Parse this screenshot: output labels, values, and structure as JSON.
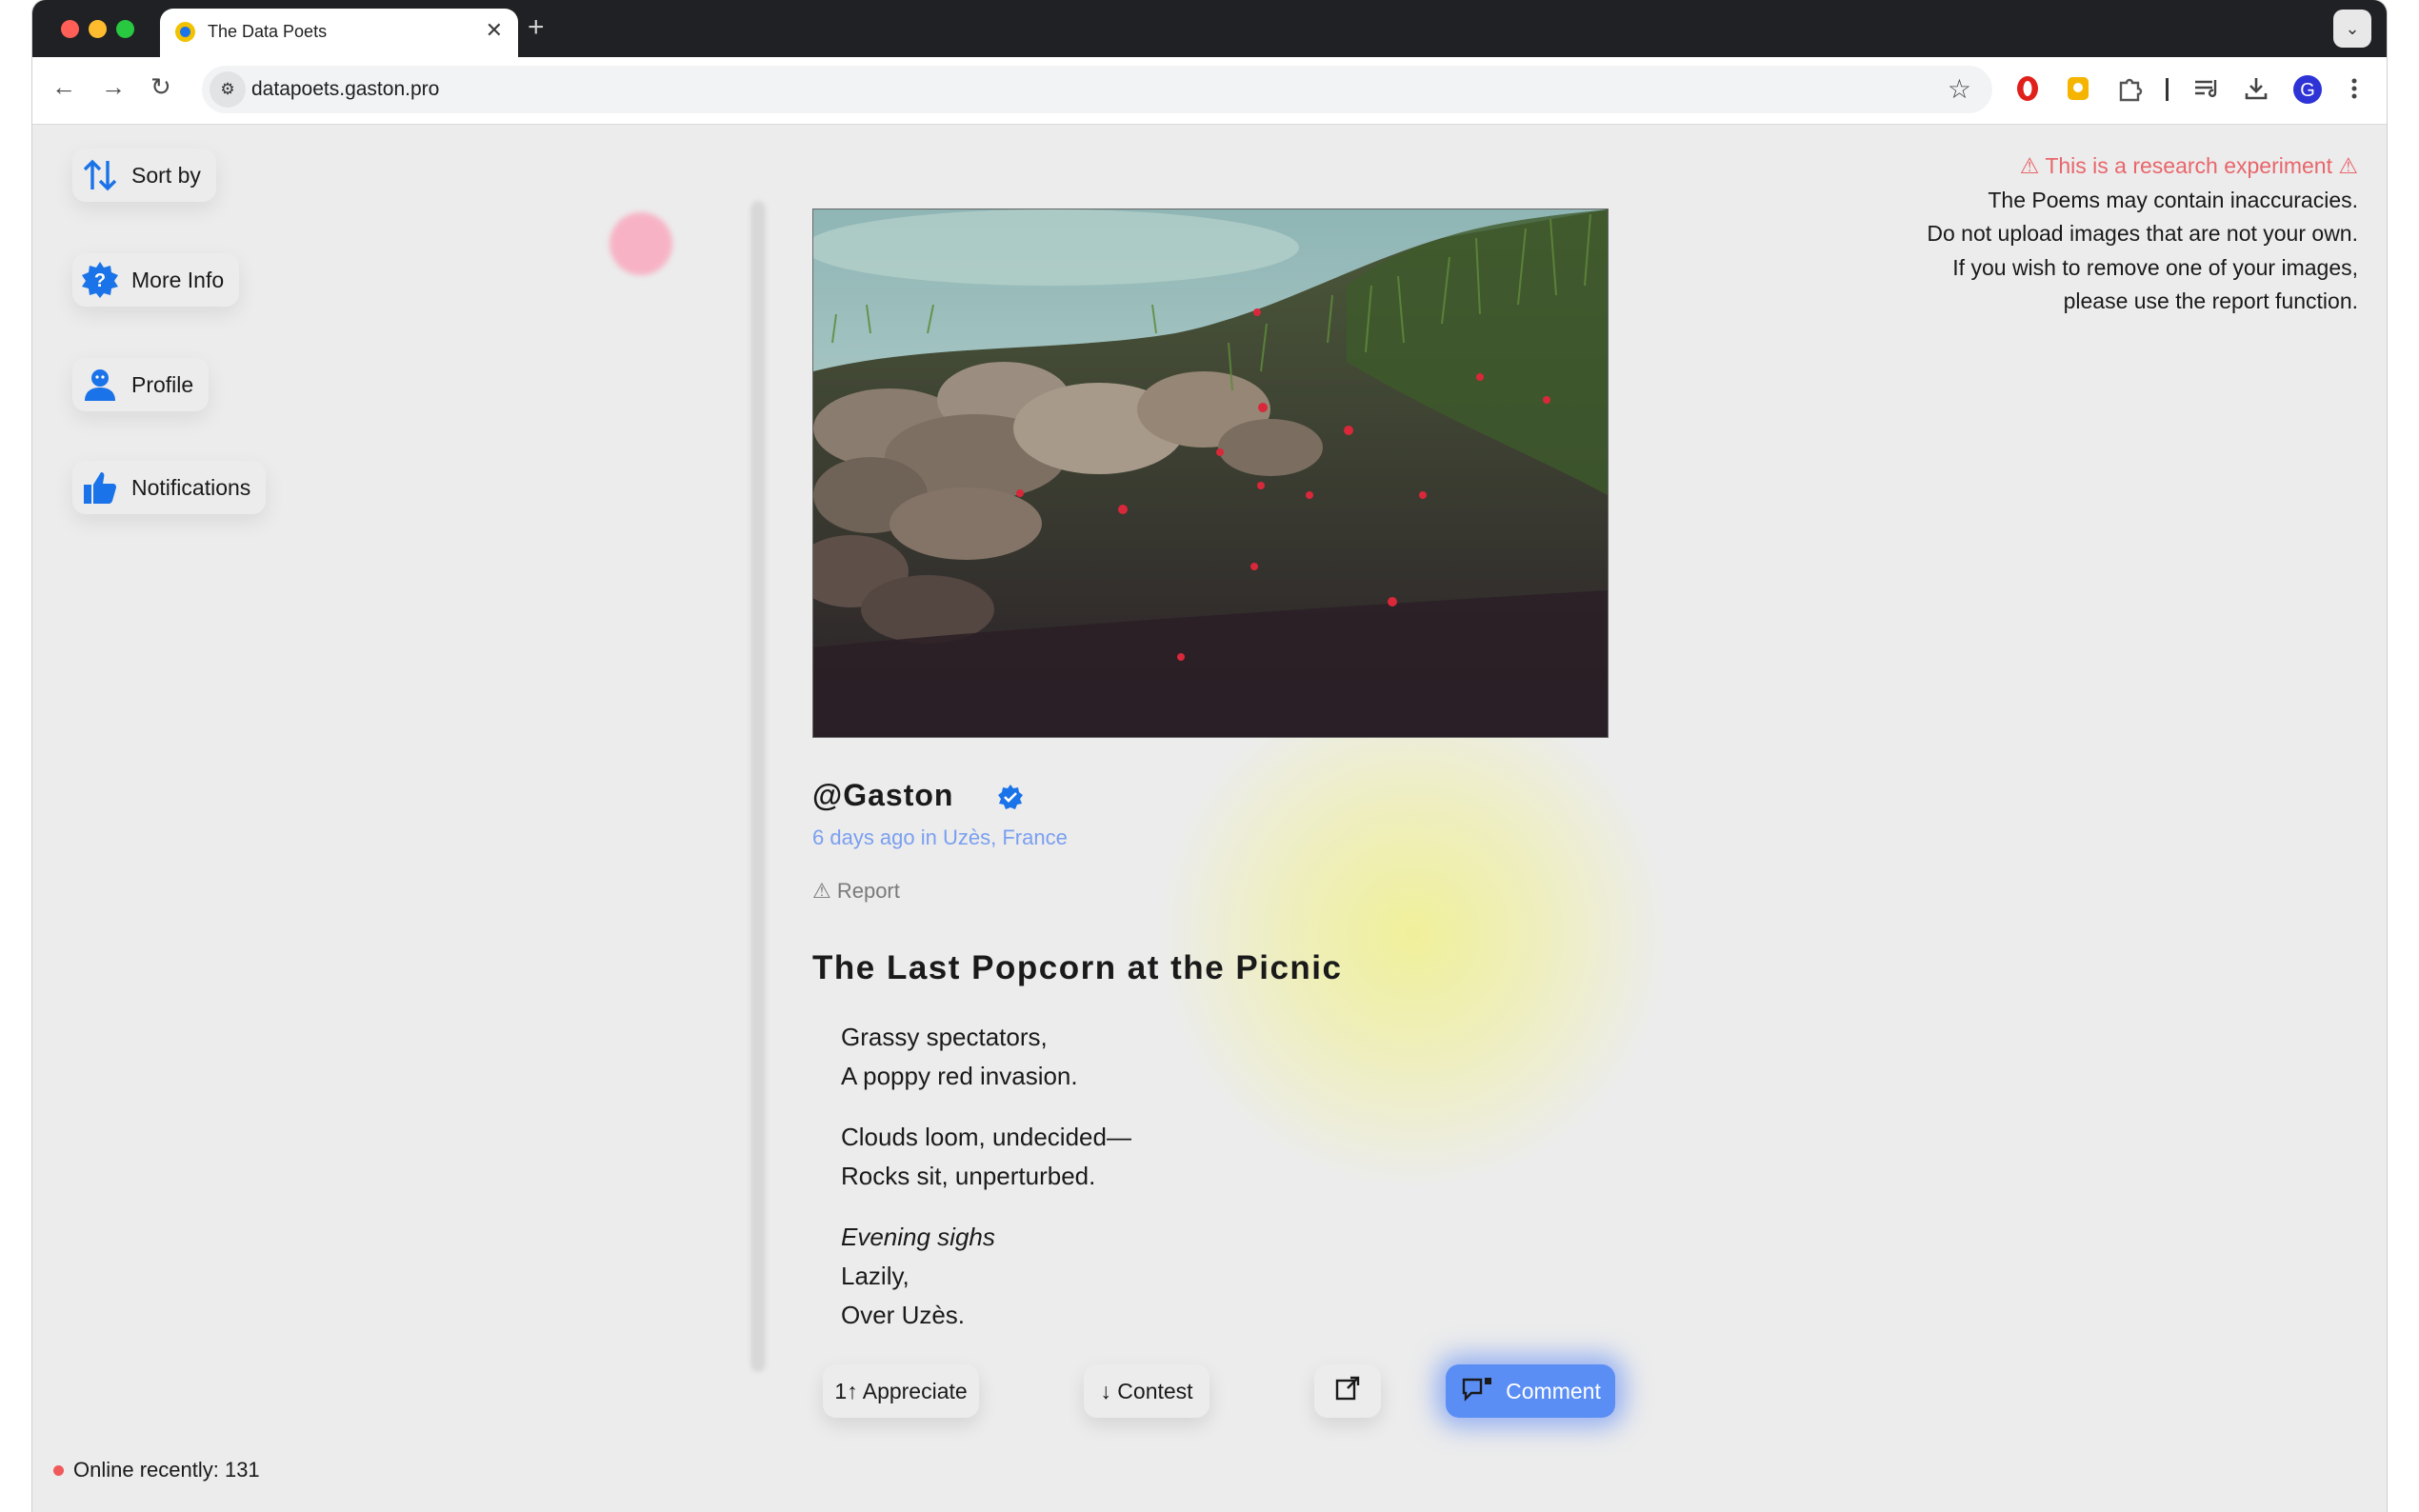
{
  "browser": {
    "tab_title": "The Data Poets",
    "tab_close": "✕",
    "new_tab": "+",
    "tab_menu": "⌄",
    "url": "datapoets.gaston.pro",
    "nav": {
      "back": "←",
      "forward": "→",
      "reload": "↻"
    },
    "bookmark_icon": "☆"
  },
  "sidebar": {
    "items": [
      {
        "label": "Sort by",
        "icon": "sort-arrows-icon"
      },
      {
        "label": "More Info",
        "icon": "question-badge-icon"
      },
      {
        "label": "Profile",
        "icon": "person-icon"
      },
      {
        "label": "Notifications",
        "icon": "thumbs-up-icon"
      }
    ]
  },
  "disclaimer": {
    "warning": "⚠ This is a research experiment ⚠",
    "lines": [
      "The Poems may contain inaccuracies.",
      "Do not upload images that are not your own.",
      "If you wish to remove one of your images,",
      "please use the report function."
    ]
  },
  "post": {
    "username": "@Gaston",
    "meta": "6 days ago in Uzès, France",
    "report": "⚠ Report",
    "title": "The Last Popcorn at the Picnic",
    "stanzas": [
      [
        "Grassy spectators,",
        "A poppy red invasion."
      ],
      [
        "Clouds loom, undecided—",
        "Rocks sit, unperturbed."
      ],
      [
        "Evening sighs",
        "Lazily,",
        "Over Uzès."
      ]
    ]
  },
  "actions": {
    "appreciate": "1↑ Appreciate",
    "contest": "↓ Contest",
    "comment": "Comment"
  },
  "status": {
    "online": "Online recently: 131"
  },
  "colors": {
    "accent": "#1a73e8",
    "warning": "#e8666b",
    "meta_link": "#7a9ff0",
    "comment_button": "#5a8ef5"
  }
}
